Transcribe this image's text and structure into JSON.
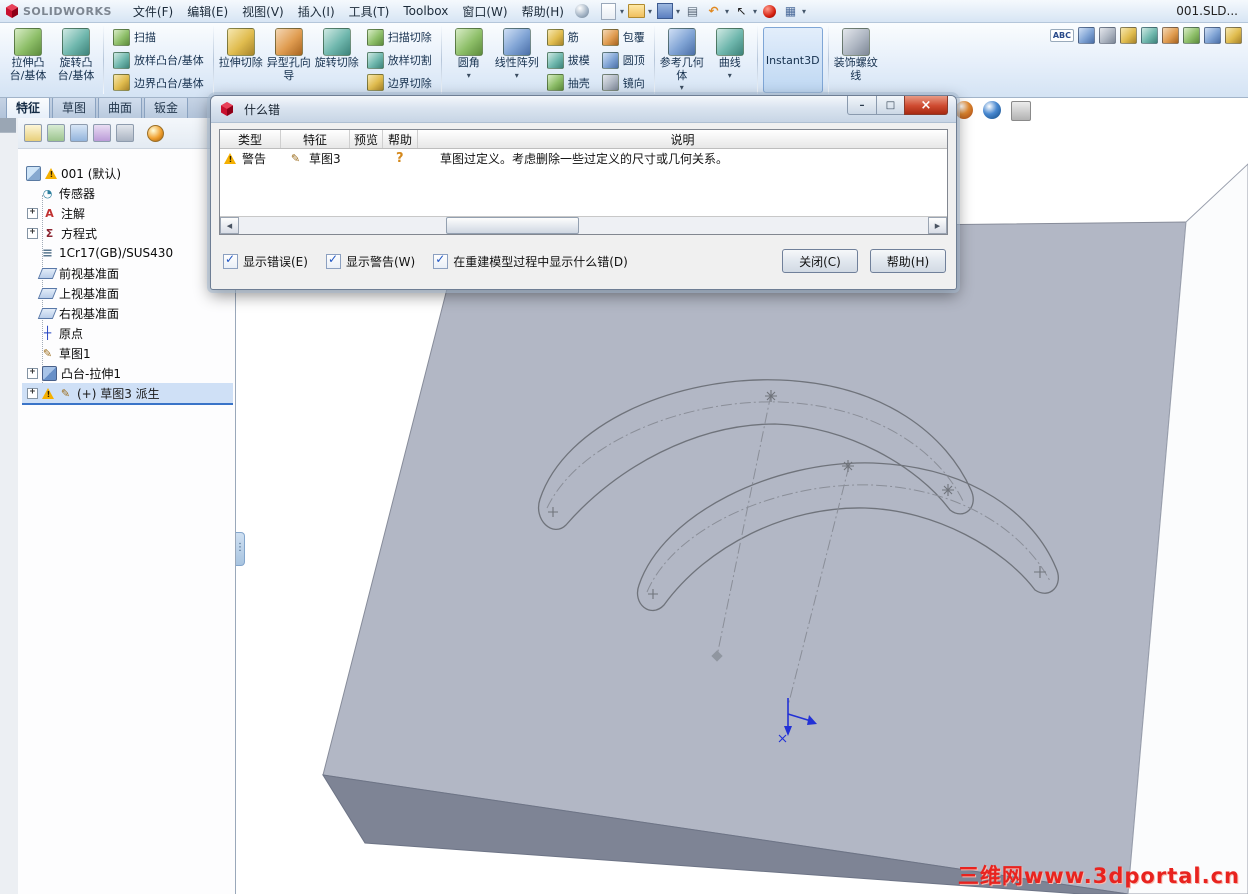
{
  "colors": {
    "accent": "#2f5fa5",
    "selection": "#cfe0f6",
    "warning": "#f5b000",
    "watermark_red": "#e8231f"
  },
  "titlebar": {
    "doc": "001.SLD..."
  },
  "brand": {
    "name": "SOLIDWORKS"
  },
  "menus": {
    "items": [
      "文件(F)",
      "编辑(E)",
      "视图(V)",
      "插入(I)",
      "工具(T)",
      "Toolbox",
      "窗口(W)",
      "帮助(H)"
    ]
  },
  "ribbon": {
    "b_extrude": "拉伸凸台/基体",
    "b_revolve": "旋转凸台/基体",
    "b_sweep": "扫描",
    "b_loft": "放样凸台/基体",
    "b_boundary": "边界凸台/基体",
    "b_cut_extrude": "拉伸切除",
    "b_hole_wizard": "异型孔向导",
    "b_cut_revolve": "旋转切除",
    "b_cut_sweep": "扫描切除",
    "b_cut_loft": "放样切割",
    "b_cut_boundary": "边界切除",
    "b_fillet": "圆角",
    "b_pattern": "线性阵列",
    "b_rib": "筋",
    "b_draft": "拔模",
    "b_shell": "抽壳",
    "b_wrap": "包覆",
    "b_dome": "圆顶",
    "b_mirror": "镜向",
    "b_refgeo": "参考几何体",
    "b_curves": "曲线",
    "b_instant3d": "Instant3D",
    "b_cosmetic": "装饰螺纹线"
  },
  "tabs": {
    "t1": "特征",
    "t2": "草图",
    "t3": "曲面",
    "t4": "钣金"
  },
  "tree": {
    "root": "001 (默认)",
    "i_sensors": "传感器",
    "i_annotations": "注解",
    "i_equations": "方程式",
    "i_material": "1Cr17(GB)/SUS430",
    "i_front": "前视基准面",
    "i_top": "上视基准面",
    "i_right": "右视基准面",
    "i_origin": "原点",
    "i_sketch1": "草图1",
    "i_extrude1": "凸台-拉伸1",
    "i_sketch3": "(+) 草图3 派生"
  },
  "dialog": {
    "title": "什么错",
    "col_type": "类型",
    "col_feature": "特征",
    "col_preview": "预览",
    "col_help": "帮助",
    "col_desc": "说明",
    "row": {
      "type": "警告",
      "feature": "草图3",
      "help": "?",
      "desc": "草图过定义。考虑删除一些过定义的尺寸或几何关系。"
    },
    "cb_errors": "显示错误(E)",
    "cb_warnings": "显示警告(W)",
    "cb_rebuild": "在重建模型过程中显示什么错(D)",
    "btn_close": "关闭(C)",
    "btn_help": "帮助(H)"
  },
  "watermark": {
    "text": "三维网www.3dportal.cn"
  }
}
